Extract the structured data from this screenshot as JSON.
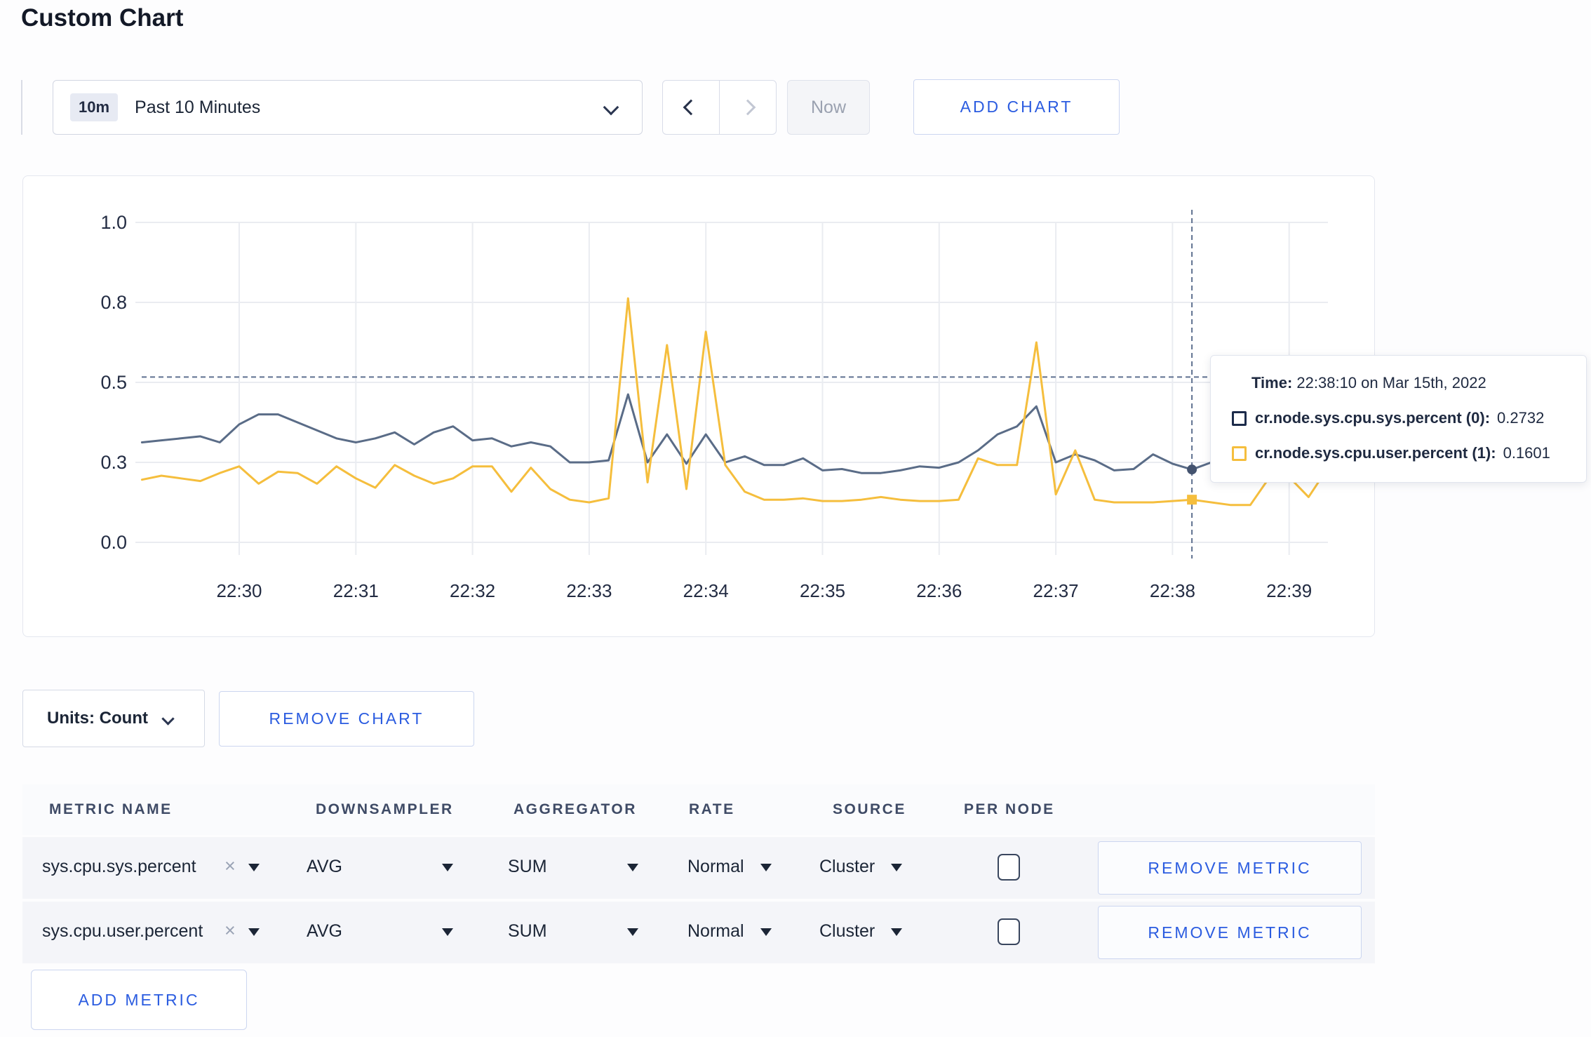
{
  "page": {
    "title": "Custom Chart"
  },
  "toolbar": {
    "time_range": {
      "badge": "10m",
      "label": "Past 10 Minutes"
    },
    "now_label": "Now",
    "add_chart_label": "ADD CHART"
  },
  "chart_data": {
    "type": "line",
    "title": "",
    "xlabel": "",
    "ylabel": "",
    "grid": true,
    "legend_position": "none",
    "x_tick_labels": [
      "22:30",
      "22:31",
      "22:32",
      "22:33",
      "22:34",
      "22:35",
      "22:36",
      "22:37",
      "22:38",
      "22:39"
    ],
    "y_ticks": [
      0,
      0.3,
      0.5,
      0.8,
      1.0
    ],
    "y_tick_labels": [
      "0.0",
      "0.3",
      "0.5",
      "0.8",
      "1.0"
    ],
    "start_time": "22:29:10",
    "interval_sec": 10,
    "series": [
      {
        "name": "cr.node.sys.cpu.sys.percent",
        "color": "#5a6c87",
        "values": [
          0.35,
          0.355,
          0.36,
          0.365,
          0.35,
          0.395,
          0.42,
          0.42,
          0.4,
          0.38,
          0.36,
          0.35,
          0.36,
          0.375,
          0.345,
          0.375,
          0.39,
          0.355,
          0.36,
          0.34,
          0.35,
          0.34,
          0.3,
          0.3,
          0.305,
          0.47,
          0.3,
          0.37,
          0.295,
          0.37,
          0.3,
          0.315,
          0.29,
          0.29,
          0.31,
          0.27,
          0.275,
          0.26,
          0.26,
          0.27,
          0.285,
          0.28,
          0.3,
          0.33,
          0.37,
          0.39,
          0.44,
          0.3,
          0.32,
          0.305,
          0.27,
          0.275,
          0.32,
          0.295,
          0.2732,
          0.3,
          0.31,
          0.3,
          0.305,
          0.31,
          0.3,
          0.305
        ]
      },
      {
        "name": "cr.node.sys.cpu.user.percent",
        "color": "#f5be3d",
        "values": [
          0.235,
          0.25,
          0.24,
          0.23,
          0.26,
          0.285,
          0.22,
          0.265,
          0.26,
          0.22,
          0.285,
          0.24,
          0.205,
          0.29,
          0.25,
          0.22,
          0.24,
          0.285,
          0.285,
          0.19,
          0.28,
          0.2,
          0.16,
          0.15,
          0.165,
          0.81,
          0.225,
          0.64,
          0.2,
          0.69,
          0.29,
          0.19,
          0.16,
          0.16,
          0.165,
          0.155,
          0.155,
          0.16,
          0.17,
          0.16,
          0.155,
          0.155,
          0.16,
          0.31,
          0.29,
          0.29,
          0.65,
          0.18,
          0.33,
          0.16,
          0.15,
          0.15,
          0.15,
          0.155,
          0.1601,
          0.15,
          0.14,
          0.14,
          0.245,
          0.245,
          0.17,
          0.28
        ]
      }
    ],
    "crosshair": {
      "time": "22:38:10",
      "hline_value": 0.52
    }
  },
  "tooltip": {
    "time_label": "Time:",
    "time_value": "22:38:10 on Mar 15th, 2022",
    "rows": [
      {
        "name": "cr.node.sys.cpu.sys.percent (0):",
        "value": "0.2732",
        "color": "#1c2b4a"
      },
      {
        "name": "cr.node.sys.cpu.user.percent (1):",
        "value": "0.1601",
        "color": "#f5be3d"
      }
    ]
  },
  "chart_footer": {
    "units_label": "Units: Count",
    "remove_chart_label": "REMOVE CHART"
  },
  "metrics_table": {
    "headers": [
      "METRIC NAME",
      "DOWNSAMPLER",
      "AGGREGATOR",
      "RATE",
      "SOURCE",
      "PER NODE"
    ],
    "rows": [
      {
        "metric": "sys.cpu.sys.percent",
        "downsampler": "AVG",
        "aggregator": "SUM",
        "rate": "Normal",
        "source": "Cluster",
        "per_node_checked": false,
        "remove_label": "REMOVE METRIC"
      },
      {
        "metric": "sys.cpu.user.percent",
        "downsampler": "AVG",
        "aggregator": "SUM",
        "rate": "Normal",
        "source": "Cluster",
        "per_node_checked": false,
        "remove_label": "REMOVE METRIC"
      }
    ],
    "add_metric_label": "ADD METRIC"
  },
  "icons": {
    "clear": "×"
  },
  "colors": {
    "accent_blue": "#2b5ce0",
    "series_sys": "#5a6c87",
    "series_user": "#f5be3d",
    "grid": "#eaecf1",
    "crosshair": "#5f7190"
  }
}
